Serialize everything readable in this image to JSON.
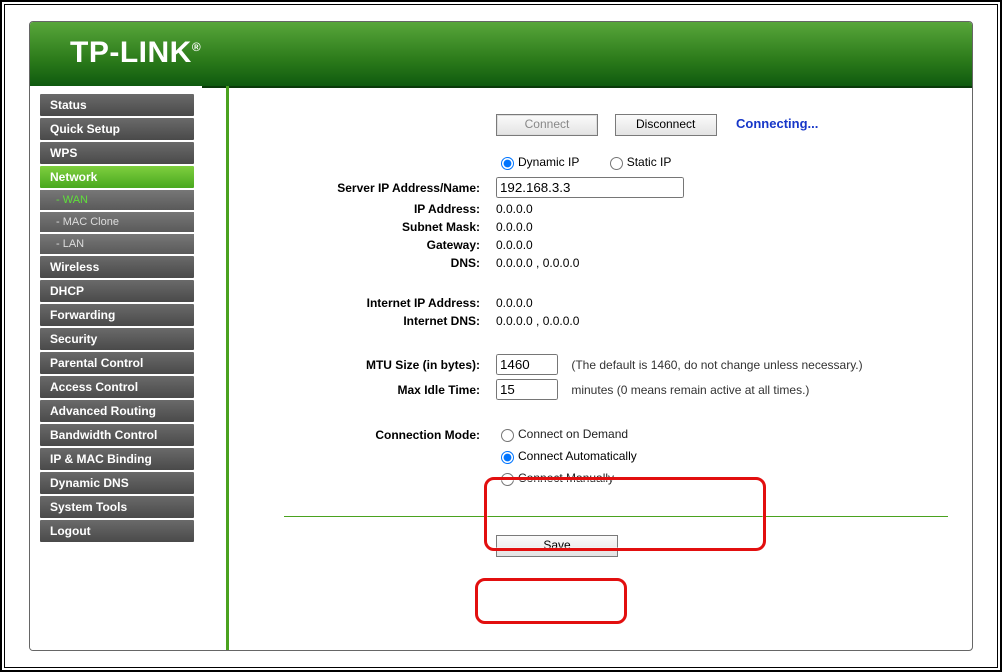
{
  "brand": "TP-LINK",
  "sidebar": {
    "items": [
      {
        "label": "Status"
      },
      {
        "label": "Quick Setup"
      },
      {
        "label": "WPS"
      },
      {
        "label": "Network",
        "active": true,
        "subs": [
          {
            "label": "- WAN",
            "selected": true
          },
          {
            "label": "- MAC Clone"
          },
          {
            "label": "- LAN"
          }
        ]
      },
      {
        "label": "Wireless"
      },
      {
        "label": "DHCP"
      },
      {
        "label": "Forwarding"
      },
      {
        "label": "Security"
      },
      {
        "label": "Parental Control"
      },
      {
        "label": "Access Control"
      },
      {
        "label": "Advanced Routing"
      },
      {
        "label": "Bandwidth Control"
      },
      {
        "label": "IP & MAC Binding"
      },
      {
        "label": "Dynamic DNS"
      },
      {
        "label": "System Tools"
      },
      {
        "label": "Logout"
      }
    ]
  },
  "topButtons": {
    "connect": "Connect",
    "disconnect": "Disconnect",
    "status": "Connecting..."
  },
  "ipMode": {
    "dynamic": "Dynamic IP",
    "static": "Static IP",
    "selected": "dynamic"
  },
  "fields": {
    "serverLabel": "Server IP Address/Name:",
    "serverValue": "192.168.3.3",
    "ipLabel": "IP Address:",
    "ipValue": "0.0.0.0",
    "maskLabel": "Subnet Mask:",
    "maskValue": "0.0.0.0",
    "gwLabel": "Gateway:",
    "gwValue": "0.0.0.0",
    "dnsLabel": "DNS:",
    "dnsValue": "0.0.0.0 , 0.0.0.0",
    "inetIpLabel": "Internet IP Address:",
    "inetIpValue": "0.0.0.0",
    "inetDnsLabel": "Internet DNS:",
    "inetDnsValue": "0.0.0.0 , 0.0.0.0",
    "mtuLabel": "MTU Size (in bytes):",
    "mtuValue": "1460",
    "mtuNote": "(The default is 1460, do not change unless necessary.)",
    "idleLabel": "Max Idle Time:",
    "idleValue": "15",
    "idleNote": "minutes (0 means remain active at all times.)"
  },
  "connMode": {
    "label": "Connection Mode:",
    "opt1": "Connect on Demand",
    "opt2": "Connect Automatically",
    "opt3": "Connect Manually",
    "selected": "opt2"
  },
  "save": "Save"
}
